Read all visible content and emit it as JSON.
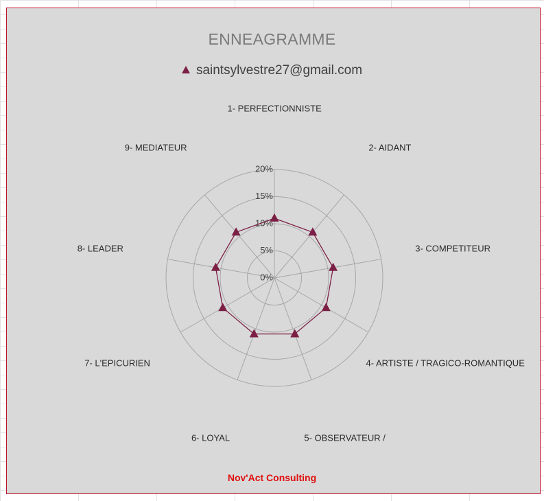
{
  "chart_data": {
    "type": "radar",
    "title": "ENNEAGRAMME",
    "categories": [
      "1- PERFECTIONNISTE",
      "2- AIDANT",
      "3- COMPETITEUR",
      "4- ARTISTE / TRAGICO-ROMANTIQUE",
      "5- OBSERVATEUR /",
      "6- LOYAL",
      "7- L'EPICURIEN",
      "8- LEADER",
      "9- MEDIATEUR"
    ],
    "series": [
      {
        "name": "saintsylvestre27@gmail.com",
        "color": "#7b1f45",
        "marker": "triangle",
        "values": [
          11,
          11,
          11,
          11,
          11,
          11,
          11,
          11,
          11
        ]
      }
    ],
    "radial_ticks": [
      "0%",
      "5%",
      "10%",
      "15%",
      "20%"
    ],
    "rlim": [
      0,
      20
    ],
    "grid": true,
    "legend": "top"
  },
  "footer": {
    "text": "Nov'Act Consulting",
    "color": "#e01010"
  },
  "colors": {
    "background": "#d9d9d9",
    "border": "#c0112b",
    "grid": "#a6a6a6"
  }
}
